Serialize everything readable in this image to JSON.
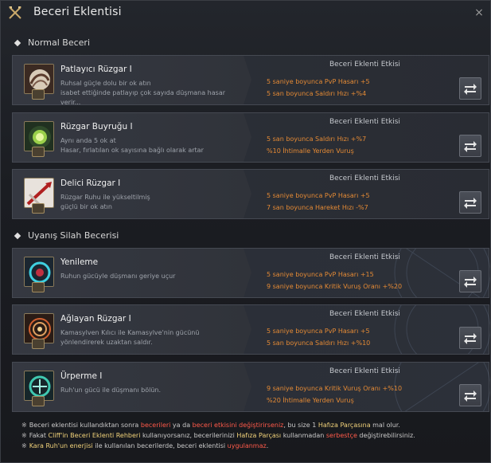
{
  "window": {
    "title": "Beceri Eklentisi",
    "close_label": "×"
  },
  "sections": {
    "normal": "Normal Beceri",
    "awakening": "Uyanış Silah Becerisi"
  },
  "effect_header": "Beceri Eklenti Etkisi",
  "normal_skills": [
    {
      "name": "Patlayıcı Rüzgar I",
      "desc1": "Ruhsal güçle dolu bir ok atın",
      "desc2": "isabet ettiğinde patlayıp çok sayıda düşmana hasar verir...",
      "effect1": "5 saniye boyunca PvP Hasarı +5",
      "effect2": "5 san boyunca Saldırı Hızı +%4",
      "icon": "whirl-arrow-icon"
    },
    {
      "name": "Rüzgar Buyruğu I",
      "desc1": "Aynı anda 5 ok at",
      "desc2": "Hasar, fırlatılan ok sayısına bağlı olarak artar",
      "effect1": "5 san boyunca Saldırı Hızı +%7",
      "effect2": "%10 İhtimalle Yerden Vuruş",
      "icon": "green-orb-icon"
    },
    {
      "name": "Delici Rüzgar I",
      "desc1": "Rüzgar Ruhu ile yükseltilmiş",
      "desc2": "güçlü bir ok atın",
      "effect1": "5 saniye boyunca PvP Hasarı +5",
      "effect2": "7 san boyunca Hareket Hızı -%7",
      "icon": "piercing-arrow-icon"
    }
  ],
  "awakening_skills": [
    {
      "name": "Yenileme",
      "desc1": "Ruhun gücüyle düşmanı geriye uçur",
      "desc2": "",
      "effect1": "5 saniye boyunca PvP Hasarı +15",
      "effect2": "9 saniye boyunca Kritik Vuruş Oranı +%20",
      "icon": "renewal-icon"
    },
    {
      "name": "Ağlayan Rüzgar I",
      "desc1": "Kamasylven Kılıcı ile Kamasylve'nin gücünü",
      "desc2": "yönlendirerek uzaktan saldır.",
      "effect1": "5 saniye boyunca PvP Hasarı +5",
      "effect2": "5 san boyunca Saldırı Hızı +%10",
      "icon": "spiral-wind-icon"
    },
    {
      "name": "Ürperme I",
      "desc1": "Ruh'un gücü ile düşmanı bölün.",
      "desc2": "",
      "effect1": "9 saniye boyunca Kritik Vuruş Oranı +%10",
      "effect2": "%20 İhtimalle Yerden Vuruş",
      "icon": "shiver-icon"
    }
  ],
  "footer": {
    "line1": {
      "a": "Beceri eklentisi kullandıktan sonra ",
      "b": "becerileri",
      "c": " ya da ",
      "d": "beceri etkisini değiştirirseniz",
      "e": ", bu size 1 ",
      "f": "Hafıza Parçasına",
      "g": " mal olur."
    },
    "line2": {
      "a": "Fakat ",
      "b": "Cliff'in Beceri Eklenti Rehberi",
      "c": " kullanıyorsanız, becerilerinizi ",
      "d": "Hafıza Parçası",
      "e": " kullanmadan ",
      "f": "serbestçe",
      "g": " değiştirebilirsiniz."
    },
    "line3": {
      "a": "Kara Ruh'un enerjisi",
      "b": " ile kullanılan becerilerde, beceri eklentisi ",
      "c": "uygulanmaz",
      "d": "."
    },
    "star": "※"
  },
  "colors": {
    "effect_text": "#e48a35",
    "highlight_red": "#ff5a4a",
    "highlight_yellow": "#f1d27a"
  }
}
